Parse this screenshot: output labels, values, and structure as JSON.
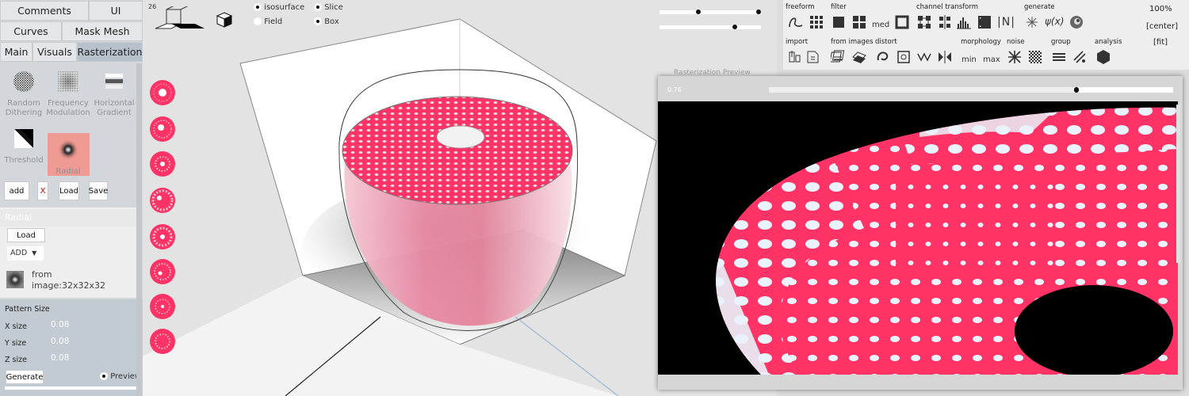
{
  "tabs": {
    "row1": [
      "Comments",
      "UI"
    ],
    "row2": [
      "Curves",
      "Mask Mesh"
    ],
    "row3": [
      "Main",
      "Visuals",
      "Rasterization"
    ],
    "active": "Rasterization"
  },
  "palette": {
    "items": [
      {
        "label": "Random Dithering"
      },
      {
        "label": "Frequency Modulation"
      },
      {
        "label": "Horizontal Gradient"
      },
      {
        "label": "Threshold"
      },
      {
        "label": "Radial",
        "selected": true
      }
    ]
  },
  "actions": {
    "add": "add",
    "remove": "X",
    "load": "Load",
    "save": "Save"
  },
  "layer": {
    "title": "Radial",
    "load": "Load",
    "mode": "ADD",
    "source_line1": "from",
    "source_line2": "image:32x32x32"
  },
  "params": {
    "header": "Pattern Size",
    "x_label": "X size",
    "x_value": "0.08",
    "y_label": "Y size",
    "y_value": "0.08",
    "z_label": "Z size",
    "z_value": "0.08",
    "generate": "Generate",
    "preview": "Preview"
  },
  "viewport": {
    "resolution": "26",
    "isosurface": "isosurface",
    "slice": "Slice",
    "field": "Field",
    "box": "Box"
  },
  "toolbar": {
    "groups": [
      "freeform",
      "filter",
      "channel transform",
      "generate",
      "import",
      "from images",
      "distort",
      "morphology",
      "noise",
      "group",
      "analysis"
    ],
    "zoom": "100%",
    "center": "[center]",
    "fit": "[fit]",
    "med": "med",
    "min": "min",
    "max": "max",
    "norm": "|N|",
    "psi_x": "ψ(x)"
  },
  "preview": {
    "title": "Rasterization Preview",
    "value": "0.76",
    "slider_fraction": 0.04
  },
  "colors": {
    "accent_pink": "#ff3366",
    "selected": "#ef9a93",
    "panel": "#d3d6da",
    "hole_light": "#e9f1f9"
  }
}
